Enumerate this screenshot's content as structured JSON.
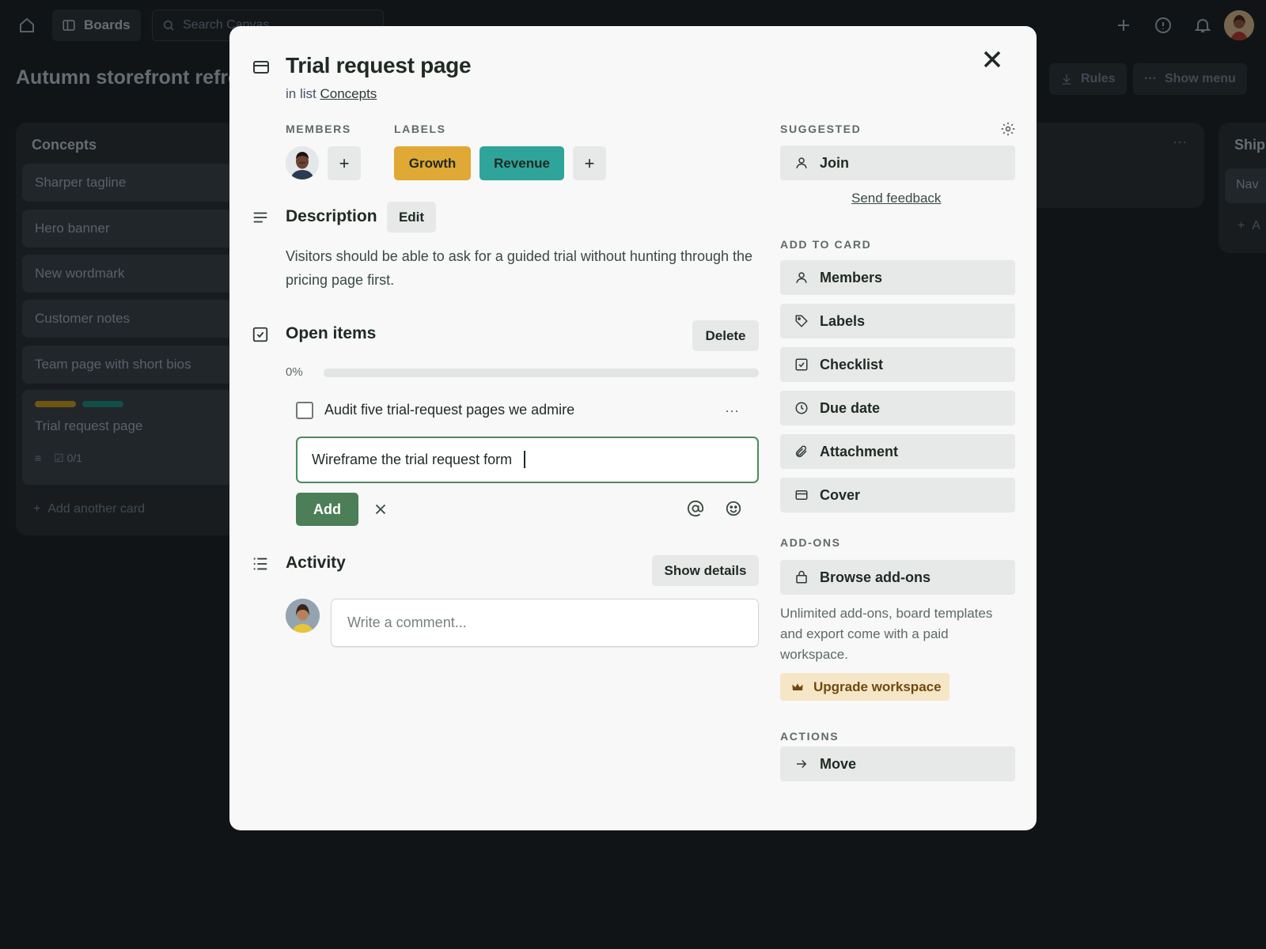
{
  "topbar": {
    "boards_label": "Boards",
    "search_placeholder": "Search Canvas"
  },
  "board": {
    "title": "Autumn storefront refresh",
    "rules_label": "Rules",
    "show_menu_label": "Show menu"
  },
  "lists": {
    "concepts": {
      "title": "Concepts",
      "cards": [
        "Sharper tagline",
        "Hero banner",
        "New wordmark",
        "Customer notes",
        "Team page with short bios"
      ],
      "active_card": {
        "title": "Trial request page",
        "checklist_count": "0/1",
        "label_colors": [
          "#c89a1e",
          "#1f8a80"
        ]
      },
      "add_card_label": "Add another card"
    },
    "right": {
      "title": "Ship",
      "card": "Nav",
      "add": "A"
    }
  },
  "modal": {
    "title": "Trial request page",
    "in_list_prefix": "in list",
    "list_name": "Concepts",
    "members_heading": "MEMBERS",
    "labels_heading": "LABELS",
    "labels": [
      {
        "text": "Growth",
        "color": "#e0a834"
      },
      {
        "text": "Revenue",
        "color": "#2fa49a"
      }
    ],
    "description": {
      "heading": "Description",
      "edit_label": "Edit",
      "text": "Visitors should be able to ask for a guided trial without hunting through the pricing page first."
    },
    "checklist": {
      "heading": "Open items",
      "delete_label": "Delete",
      "progress_label": "0%",
      "progress_fraction": 0,
      "items": [
        {
          "text": "Audit five trial-request pages we admire",
          "checked": false
        }
      ],
      "new_item_value": "Wireframe the trial request form",
      "add_label": "Add"
    },
    "activity": {
      "heading": "Activity",
      "show_details_label": "Show details",
      "comment_placeholder": "Write a comment..."
    },
    "sidebar": {
      "suggested_heading": "SUGGESTED",
      "join_label": "Join",
      "send_feedback_label": "Send feedback",
      "add_to_card_heading": "ADD TO CARD",
      "add_to_card": [
        "Members",
        "Labels",
        "Checklist",
        "Due date",
        "Attachment",
        "Cover"
      ],
      "addons_heading": "ADD-ONS",
      "browse_addons_label": "Browse add-ons",
      "addons_note": "Unlimited add-ons, board templates and export come with a paid workspace.",
      "upgrade_label": "Upgrade workspace",
      "actions_heading": "ACTIONS",
      "move_label": "Move"
    }
  },
  "colors": {
    "accent_green": "#4c7e57",
    "progress_track": "#e2e5e3",
    "upgrade_bg": "#f6e6c8"
  }
}
